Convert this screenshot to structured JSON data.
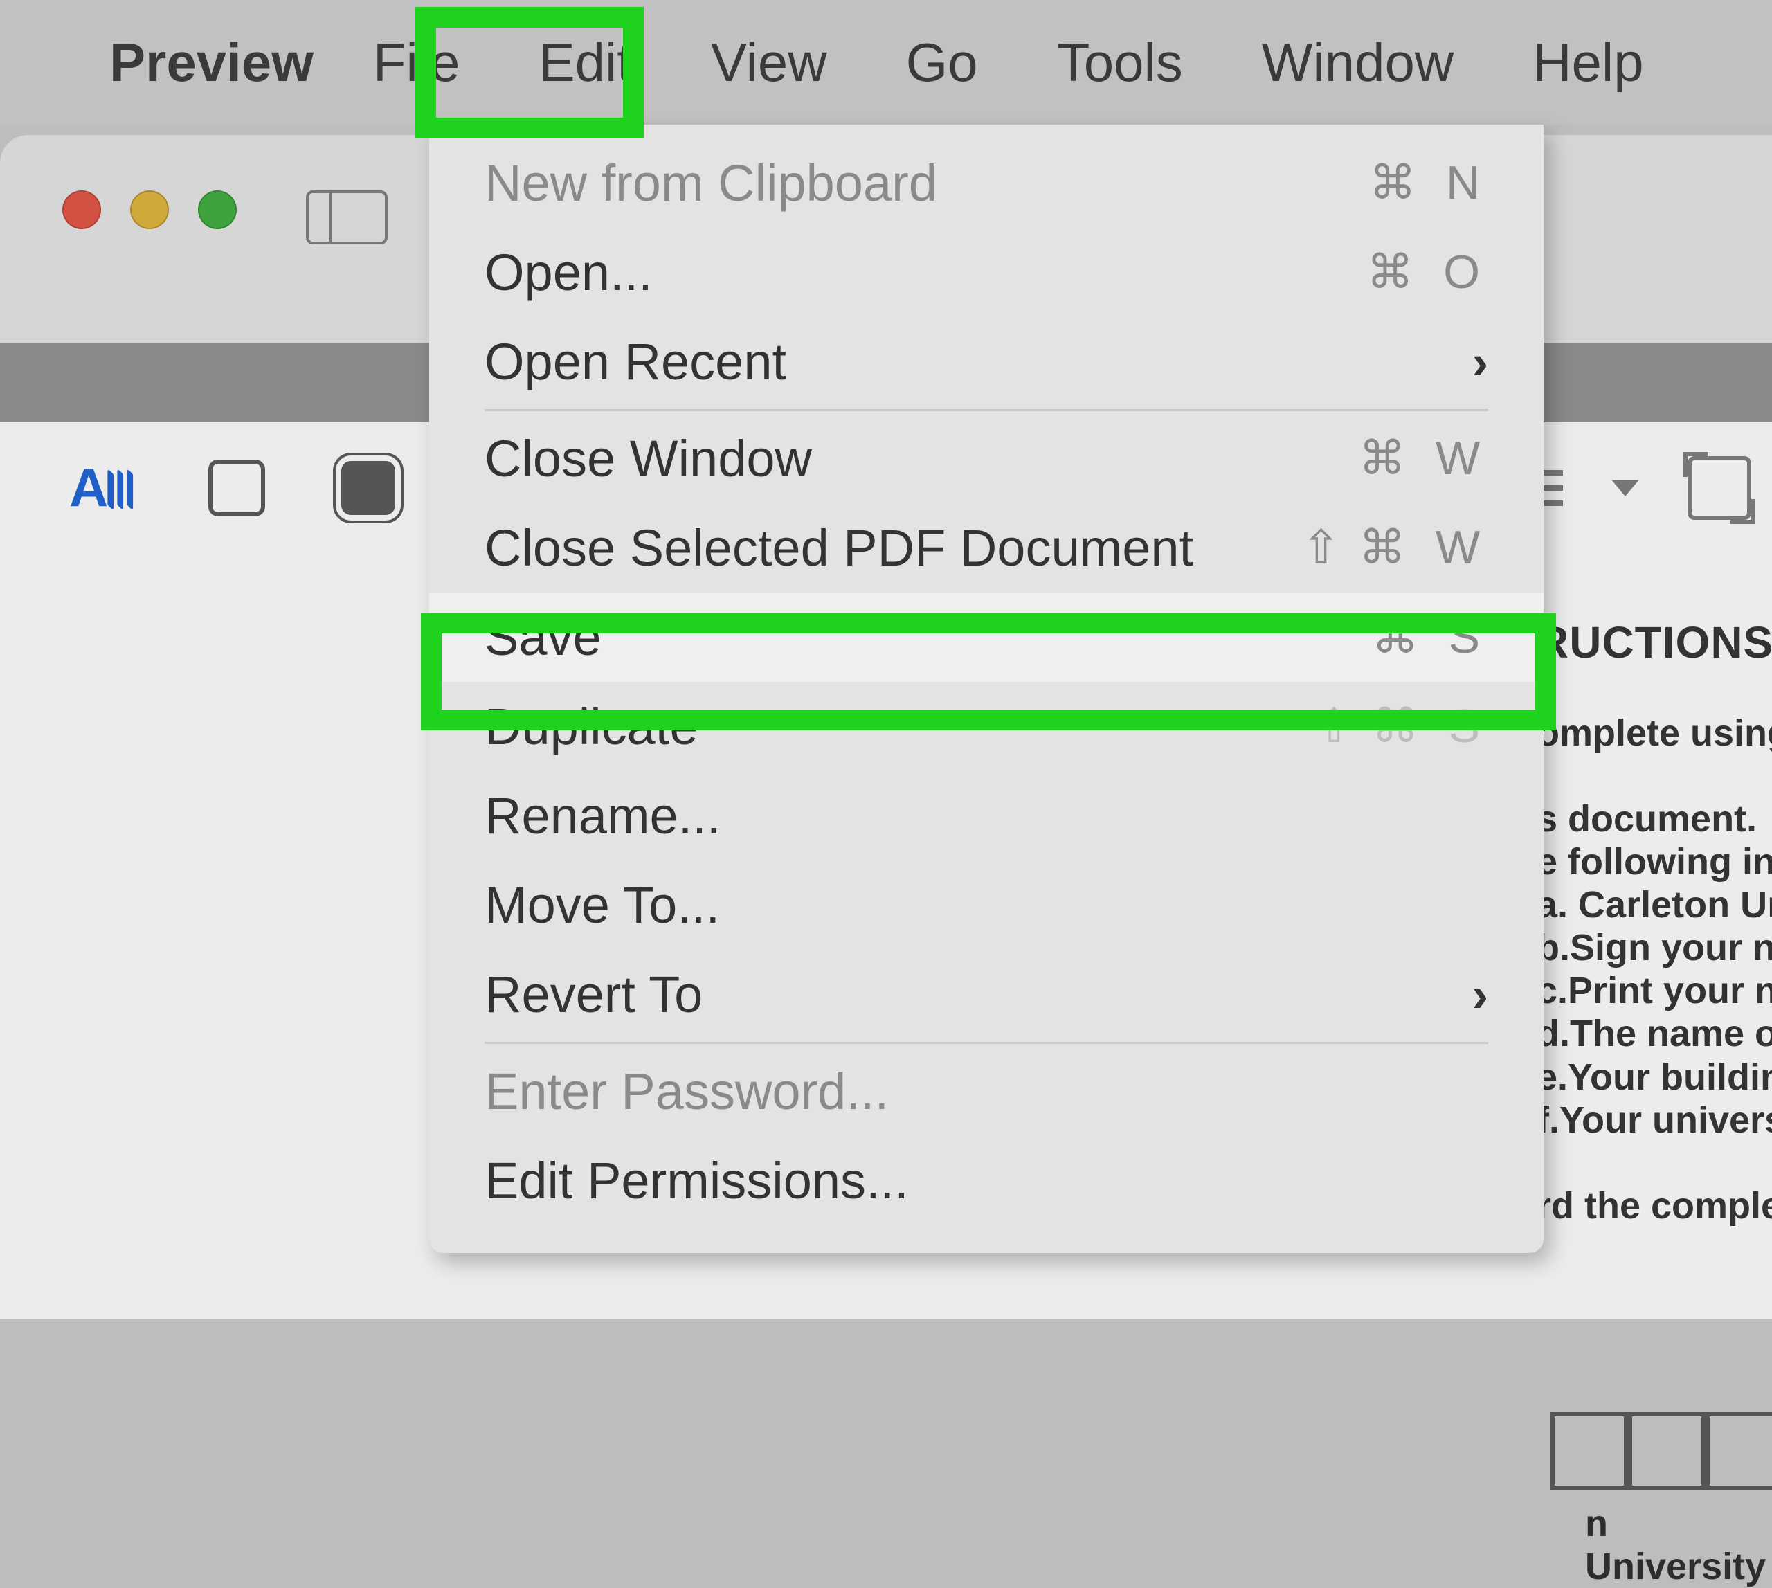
{
  "menubar": {
    "app_name": "Preview",
    "items": [
      "File",
      "Edit",
      "View",
      "Go",
      "Tools",
      "Window",
      "Help"
    ]
  },
  "dropdown": {
    "items": [
      {
        "label": "New from Clipboard",
        "shortcut": "⌘ N",
        "disabled": true
      },
      {
        "label": "Open...",
        "shortcut": "⌘ O"
      },
      {
        "label": "Open Recent",
        "submenu": true
      },
      {
        "sep": true
      },
      {
        "label": "Close Window",
        "shortcut": "⌘ W"
      },
      {
        "label": "Close Selected PDF Document",
        "shortcut": "⌘ W",
        "shift": true
      },
      {
        "label": "Save",
        "shortcut": "⌘ S",
        "highlight": true
      },
      {
        "label": "Duplicate",
        "shortcut": "⌘ S",
        "shift": true,
        "disabled_shortcut": true
      },
      {
        "label": "Rename..."
      },
      {
        "label": "Move To..."
      },
      {
        "label": "Revert To",
        "submenu": true
      },
      {
        "sep": true
      },
      {
        "label": "Enter Password...",
        "disabled": true
      },
      {
        "label": "Edit Permissions..."
      }
    ]
  },
  "document": {
    "heading": "RUCTIONS:",
    "lines": [
      "omplete using a",
      "",
      "s document.",
      "e following in t",
      "a. Carleton Un",
      "b.Sign your na",
      "c.Print your na",
      "d.The name of",
      "e.Your building",
      "f.Your universit",
      "",
      "rd the complete"
    ],
    "footer": "n University"
  }
}
